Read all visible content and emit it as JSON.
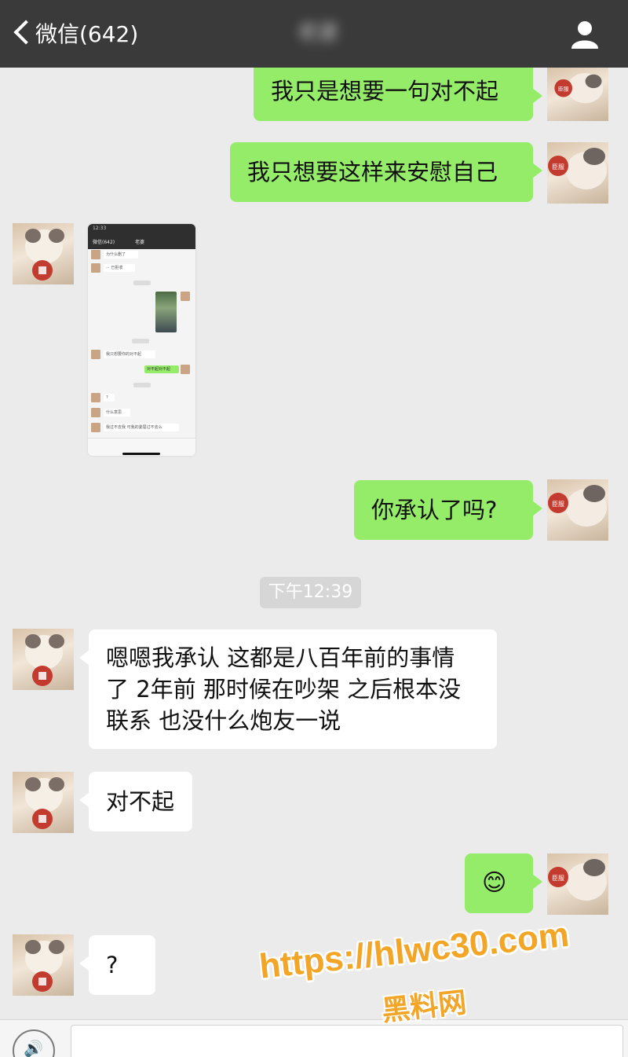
{
  "header": {
    "back_label": "微信(642)",
    "title": "老婆"
  },
  "messages": [
    {
      "side": "me",
      "text": "我只是想要一句对不起"
    },
    {
      "side": "me",
      "text": "我只想要这样来安慰自己"
    },
    {
      "side": "them",
      "type": "image"
    },
    {
      "side": "me",
      "text": "你承认了吗?"
    },
    {
      "side": "them",
      "lines": [
        "嗯嗯我承认 这都是八百年前的事情",
        "了 2年前 那时候在吵架 之后根本没",
        "联系 也没什么炮友一说"
      ]
    },
    {
      "side": "them",
      "text": "对不起"
    },
    {
      "side": "me",
      "text": "😊"
    },
    {
      "side": "them",
      "text": "?"
    }
  ],
  "timestamp": "下午12:39",
  "thumbnail": {
    "status_time": "12:33",
    "back_label": "微信(642)",
    "title": "老婆",
    "texts": [
      "为什么删了",
      "··· 已拒收",
      "我只想要你的对不起",
      "对不起对不起",
      "?",
      "什么意思",
      "我过不去我 可我的委屈过不去么"
    ]
  },
  "avatar_badge": "臣服",
  "watermark": {
    "url": "https://hlwc30.com",
    "label": "黑料网"
  },
  "colors": {
    "sent_bubble": "#95ec69",
    "received_bubble": "#ffffff",
    "background": "#ebebeb",
    "header": "#3a3a3a",
    "watermark": "#f2a527"
  }
}
